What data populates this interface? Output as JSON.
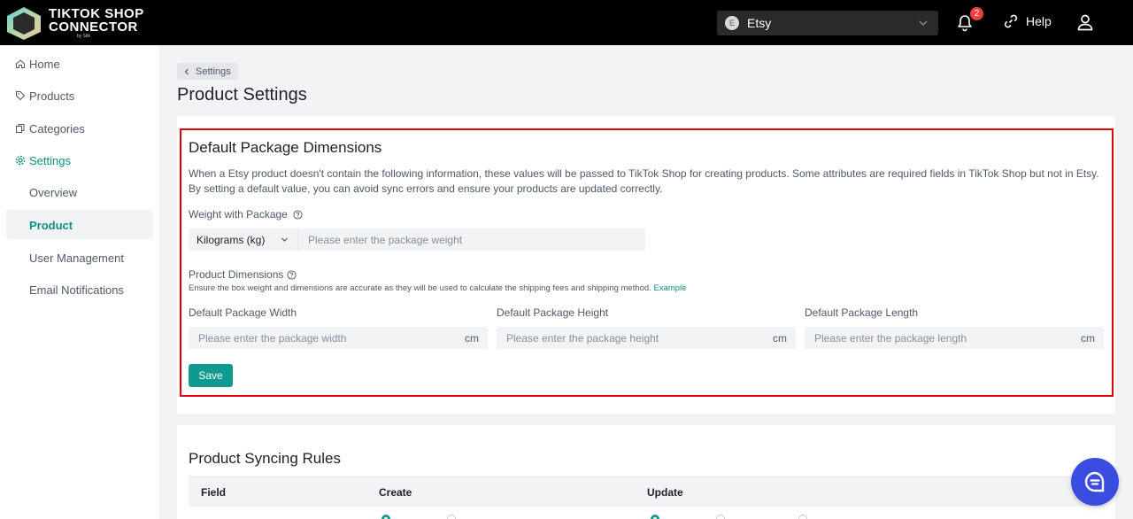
{
  "brand": {
    "line1": "TIKTOK SHOP",
    "line2": "CONNECTOR",
    "sub": "by Sitk"
  },
  "header": {
    "store_avatar_letter": "E",
    "store_name": "Etsy",
    "notification_count": "2",
    "help_label": "Help"
  },
  "sidebar": {
    "items": [
      {
        "label": "Home",
        "icon": "home-icon"
      },
      {
        "label": "Products",
        "icon": "tag-icon"
      },
      {
        "label": "Categories",
        "icon": "copy-icon"
      },
      {
        "label": "Settings",
        "icon": "gear-icon"
      }
    ],
    "settings_sub": [
      {
        "label": "Overview"
      },
      {
        "label": "Product"
      },
      {
        "label": "User Management"
      },
      {
        "label": "Email Notifications"
      }
    ]
  },
  "breadcrumb": {
    "label": "Settings"
  },
  "page": {
    "title": "Product Settings"
  },
  "package": {
    "title": "Default Package Dimensions",
    "description": "When a Etsy product doesn't contain the following information, these values will be passed to TikTok Shop for creating products. Some attributes are required fields in TikTok Shop but not in Etsy. By setting a default value, you can avoid sync errors and ensure your products are updated correctly.",
    "weight_label": "Weight with Package",
    "unit_selected": "Kilograms (kg)",
    "weight_placeholder": "Please enter the package weight",
    "dimensions_label": "Product Dimensions",
    "dimensions_hint": "Ensure the box weight and dimensions are accurate as they will be used to calculate the shipping fees and shipping method.",
    "example_link": "Example",
    "width_label": "Default Package Width",
    "width_placeholder": "Please enter the package width",
    "height_label": "Default Package Height",
    "height_placeholder": "Please enter the package height",
    "length_label": "Default Package Length",
    "length_placeholder": "Please enter the package length",
    "unit_suffix": "cm",
    "save_label": "Save"
  },
  "syncing": {
    "title": "Product Syncing Rules",
    "columns": [
      "Field",
      "Create",
      "Update"
    ]
  },
  "colors": {
    "accent": "#0f9a8f",
    "highlight": "#e60000",
    "fab": "#3b4de0"
  }
}
